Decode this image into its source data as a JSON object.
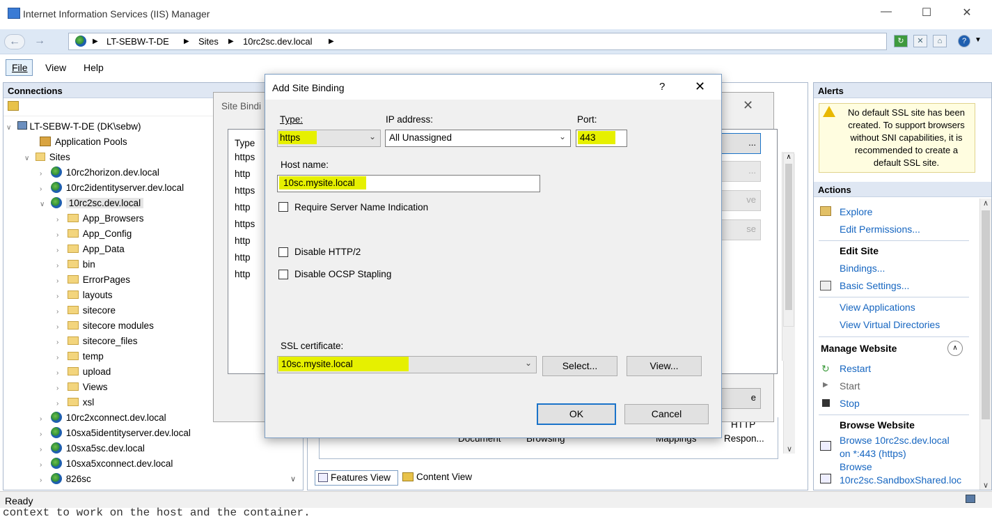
{
  "window": {
    "title": "Internet Information Services (IIS) Manager"
  },
  "address": {
    "crumbs": [
      "LT-SEBW-T-DE",
      "Sites",
      "10rc2sc.dev.local"
    ]
  },
  "menu": {
    "file": "File",
    "view": "View",
    "help": "Help"
  },
  "connections": {
    "header": "Connections",
    "server": "LT-SEBW-T-DE (DK\\sebw)",
    "app_pools": "Application Pools",
    "sites_label": "Sites",
    "sites_top": [
      "10rc2horizon.dev.local",
      "10rc2identityserver.dev.local",
      "10rc2sc.dev.local"
    ],
    "folders": [
      "App_Browsers",
      "App_Config",
      "App_Data",
      "bin",
      "ErrorPages",
      "layouts",
      "sitecore",
      "sitecore modules",
      "sitecore_files",
      "temp",
      "upload",
      "Views",
      "xsl"
    ],
    "sites_bottom": [
      "10rc2xconnect.dev.local",
      "10sxa5identityserver.dev.local",
      "10sxa5sc.dev.local",
      "10sxa5xconnect.dev.local",
      "826sc"
    ]
  },
  "main": {
    "features_view": "Features View",
    "content_view": "Content View",
    "icon_labels": [
      "Document",
      "Browsing",
      "Mappings",
      "HTTP",
      "Respon..."
    ]
  },
  "site_bindings": {
    "title": "Site Bindi",
    "col_type": "Type",
    "types": [
      "https",
      "http",
      "https",
      "http",
      "https",
      "http",
      "http",
      "http"
    ],
    "btn_add": "...",
    "btn_edit": "...",
    "btn_remove": "ve",
    "btn_browse": "se",
    "btn_close": "e"
  },
  "add_binding": {
    "title": "Add Site Binding",
    "help": "?",
    "type_label": "Type:",
    "type_value": "https",
    "ip_label": "IP address:",
    "ip_value": "All Unassigned",
    "port_label": "Port:",
    "port_value": "443",
    "host_label": "Host name:",
    "host_value": "10sc.mysite.local",
    "sni_label": "Require Server Name Indication",
    "http2_label": "Disable HTTP/2",
    "ocsp_label": "Disable OCSP Stapling",
    "ssl_label": "SSL certificate:",
    "ssl_value": "10sc.mysite.local",
    "select_btn": "Select...",
    "view_btn": "View...",
    "ok_btn": "OK",
    "cancel_btn": "Cancel"
  },
  "alerts": {
    "header": "Alerts",
    "message": "No default SSL site has been created. To support browsers without SNI capabilities, it is recommended to create a default SSL site."
  },
  "actions": {
    "header": "Actions",
    "explore": "Explore",
    "edit_permissions": "Edit Permissions...",
    "edit_site": "Edit Site",
    "bindings": "Bindings...",
    "basic_settings": "Basic Settings...",
    "view_applications": "View Applications",
    "view_vdirs": "View Virtual Directories",
    "manage_website": "Manage Website",
    "restart": "Restart",
    "start": "Start",
    "stop": "Stop",
    "browse_website": "Browse Website",
    "browse1_a": "Browse 10rc2sc.dev.local",
    "browse1_b": "on *:443 (https)",
    "browse2_a": "Browse",
    "browse2_b": "10rc2sc.SandboxShared.loc"
  },
  "status": {
    "text": "Ready"
  },
  "bottom_text": "context to work on the host and the container."
}
